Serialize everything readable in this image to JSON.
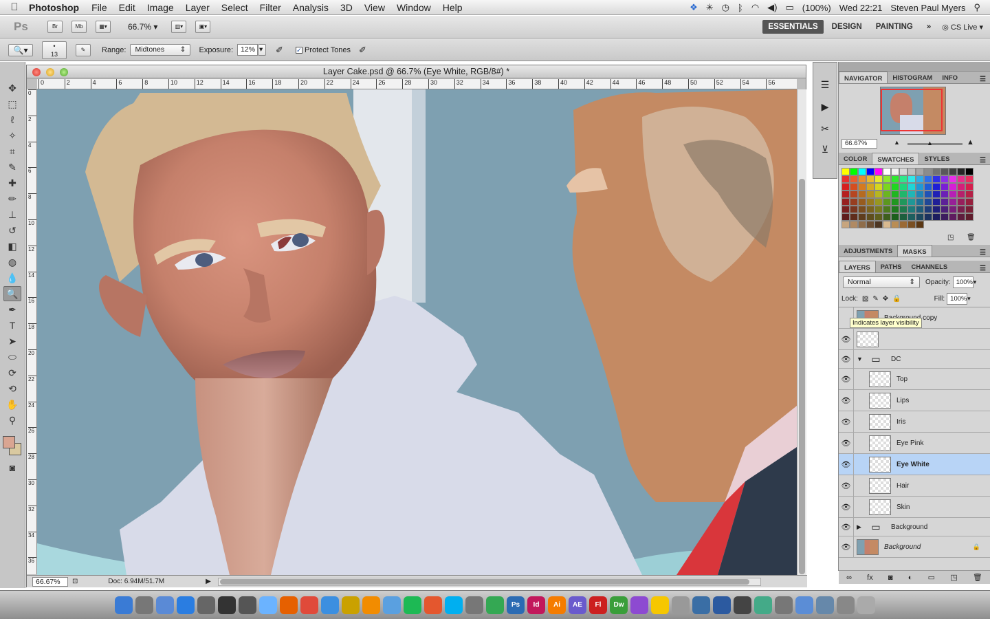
{
  "menubar": {
    "app": "Photoshop",
    "items": [
      "File",
      "Edit",
      "Image",
      "Layer",
      "Select",
      "Filter",
      "Analysis",
      "3D",
      "View",
      "Window",
      "Help"
    ],
    "battery": "(100%)",
    "clock": "Wed 22:21",
    "user": "Steven Paul Myers"
  },
  "appbar": {
    "logo": "Ps",
    "bridge": "Br",
    "minibridge": "Mb",
    "zoom": "66.7%",
    "workspaces": [
      "ESSENTIALS",
      "DESIGN",
      "PAINTING"
    ],
    "more": "»",
    "cslive": "CS Live"
  },
  "options": {
    "brush_size": "13",
    "range_label": "Range:",
    "range_value": "Midtones",
    "exposure_label": "Exposure:",
    "exposure_value": "12%",
    "protect_label": "Protect Tones"
  },
  "document": {
    "title": "Layer Cake.psd @ 66.7% (Eye White, RGB/8#) *",
    "zoom": "66.67%",
    "doc_size": "Doc: 6.94M/51.7M",
    "ruler_marks": [
      "0",
      "2",
      "4",
      "6",
      "8",
      "10",
      "12",
      "14",
      "16",
      "18",
      "20",
      "22",
      "24",
      "26",
      "28",
      "30",
      "32",
      "34",
      "36",
      "38",
      "40",
      "42",
      "44",
      "46",
      "48",
      "50",
      "52",
      "54",
      "56"
    ],
    "ruler_left_marks": [
      "0",
      "2",
      "4",
      "6",
      "8",
      "10",
      "12",
      "14",
      "16",
      "18",
      "20",
      "22",
      "24",
      "26",
      "28",
      "30",
      "32",
      "34",
      "36",
      "38"
    ]
  },
  "navigator": {
    "tabs": [
      "NAVIGATOR",
      "HISTOGRAM",
      "INFO"
    ],
    "zoom": "66.67%"
  },
  "color_panel": {
    "tabs": [
      "COLOR",
      "SWATCHES",
      "STYLES"
    ]
  },
  "adjust_panel": {
    "tabs": [
      "ADJUSTMENTS",
      "MASKS"
    ]
  },
  "layers_panel": {
    "tabs": [
      "LAYERS",
      "PATHS",
      "CHANNELS"
    ],
    "blend_mode": "Normal",
    "opacity_label": "Opacity:",
    "opacity": "100%",
    "lock_label": "Lock:",
    "fill_label": "Fill:",
    "fill": "100%",
    "tooltip": "Indicates layer visibility",
    "layers": [
      {
        "name": "Background copy",
        "visible": false,
        "indent": 0
      },
      {
        "name": "",
        "visible": true,
        "indent": 0
      },
      {
        "name": "DC",
        "visible": true,
        "indent": 0,
        "group": true
      },
      {
        "name": "Top",
        "visible": true,
        "indent": 1
      },
      {
        "name": "Lips",
        "visible": true,
        "indent": 1
      },
      {
        "name": "Iris",
        "visible": true,
        "indent": 1
      },
      {
        "name": "Eye Pink",
        "visible": true,
        "indent": 1
      },
      {
        "name": "Eye White",
        "visible": true,
        "indent": 1,
        "selected": true
      },
      {
        "name": "Hair",
        "visible": true,
        "indent": 1
      },
      {
        "name": "Skin",
        "visible": true,
        "indent": 1
      },
      {
        "name": "Background",
        "visible": true,
        "indent": 0,
        "group": true
      },
      {
        "name": "Background",
        "visible": true,
        "indent": 0,
        "locked": true
      }
    ]
  },
  "dock": {
    "icons": [
      "finder",
      "rocket",
      "preview",
      "appstore",
      "system",
      "dashboard",
      "time",
      "itunes",
      "firefox",
      "chrome",
      "safari",
      "word",
      "vlc",
      "itunes2",
      "spotify",
      "kt",
      "skype",
      "pen",
      "drive",
      "Ps",
      "Id",
      "Ai",
      "AE",
      "Fl",
      "Dw",
      "br",
      "duck",
      "mail",
      "maps",
      "disk",
      "itunes3",
      "camera",
      "folder",
      "bird",
      "globe",
      "browser",
      "trash"
    ]
  },
  "colors": {
    "fg_swatch": "#d9a592",
    "bg_swatch": "#d9c9a0",
    "selected_layer": "#b8d4f6"
  }
}
